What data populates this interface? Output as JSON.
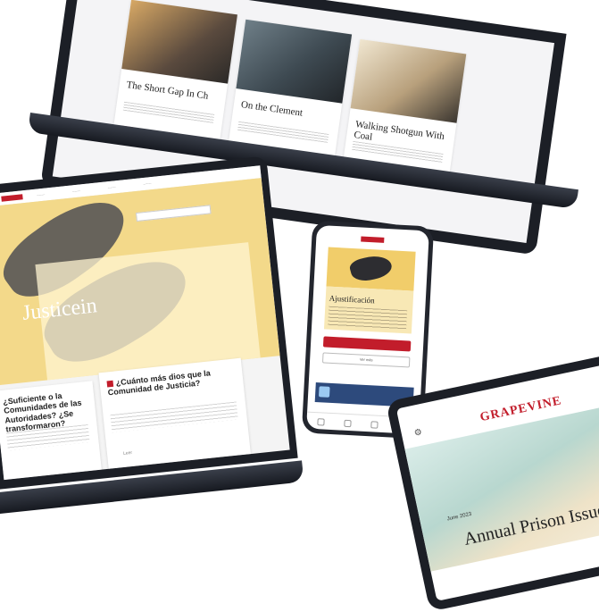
{
  "top_laptop": {
    "cards": [
      {
        "title": "The Short Gap In Ch"
      },
      {
        "title": "On the Clement"
      },
      {
        "title": "Walking Shotgun With Coal"
      }
    ]
  },
  "left_laptop": {
    "search_placeholder": "",
    "hero_title": "Justicein",
    "cards": [
      {
        "title": "¿Suficiente o la Comunidades de las Autoridades? ¿Se transformaron?"
      },
      {
        "title": "¿Cuánto más dios que la Comunidad de Justicia?",
        "more": "Leer"
      }
    ]
  },
  "phone": {
    "article_title": "Ajustificación",
    "primary_button": "",
    "secondary_button": "Ver más"
  },
  "tablet": {
    "logo": "GRAPEVINE",
    "issue_date": "June 2023",
    "headline": "Annual Prison Issue"
  }
}
